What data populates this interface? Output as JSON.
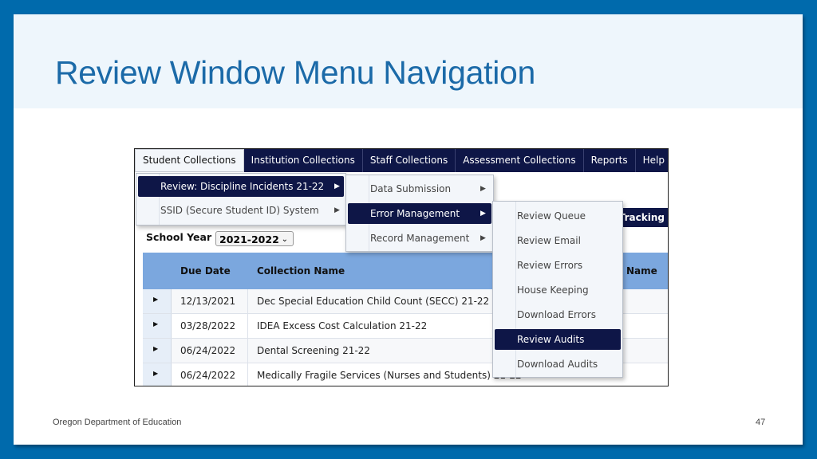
{
  "slide": {
    "title": "Review Window Menu Navigation",
    "footer_org": "Oregon Department of Education",
    "page_number": "47",
    "colors": {
      "frame": "#006aac",
      "title": "#1b6aa8",
      "menubar": "#0e1647",
      "grid_header": "#7ba7de"
    }
  },
  "menubar": {
    "items": [
      "Student Collections",
      "Institution Collections",
      "Staff Collections",
      "Assessment Collections",
      "Reports",
      "Help"
    ],
    "active_index": 0
  },
  "submenu1": {
    "items": [
      {
        "label": "Review: Discipline Incidents 21-22",
        "selected": true,
        "arrow": "▶"
      },
      {
        "label": "SSID (Secure Student ID) System",
        "selected": false,
        "arrow": "▶"
      }
    ]
  },
  "submenu2": {
    "items": [
      {
        "label": "Data Submission",
        "selected": false,
        "arrow": "▶"
      },
      {
        "label": "Error Management",
        "selected": true,
        "arrow": "▶"
      },
      {
        "label": "Record Management",
        "selected": false,
        "arrow": "▶"
      }
    ]
  },
  "submenu3": {
    "items": [
      {
        "label": "Review Queue",
        "selected": false
      },
      {
        "label": "Review Email",
        "selected": false
      },
      {
        "label": "Review Errors",
        "selected": false
      },
      {
        "label": "House Keeping",
        "selected": false
      },
      {
        "label": "Download Errors",
        "selected": false
      },
      {
        "label": "Review Audits",
        "selected": true
      },
      {
        "label": "Download Audits",
        "selected": false
      }
    ]
  },
  "filters": {
    "school_year_label": "School Year :",
    "school_year_value": "2021-2022",
    "chevron": "⌄"
  },
  "tracking_label": "Tracking",
  "grid": {
    "headers": {
      "due_date": "Due Date",
      "collection_name": "Collection Name",
      "name": "Name"
    },
    "expander_glyph": "▶",
    "rows": [
      {
        "due_date": "12/13/2021",
        "collection_name": "Dec Special Education Child Count (SECC) 21-22"
      },
      {
        "due_date": "03/28/2022",
        "collection_name": "IDEA Excess Cost Calculation 21-22"
      },
      {
        "due_date": "06/24/2022",
        "collection_name": "Dental Screening 21-22"
      },
      {
        "due_date": "06/24/2022",
        "collection_name": "Medically Fragile Services (Nurses and Students) 21-22"
      }
    ]
  }
}
